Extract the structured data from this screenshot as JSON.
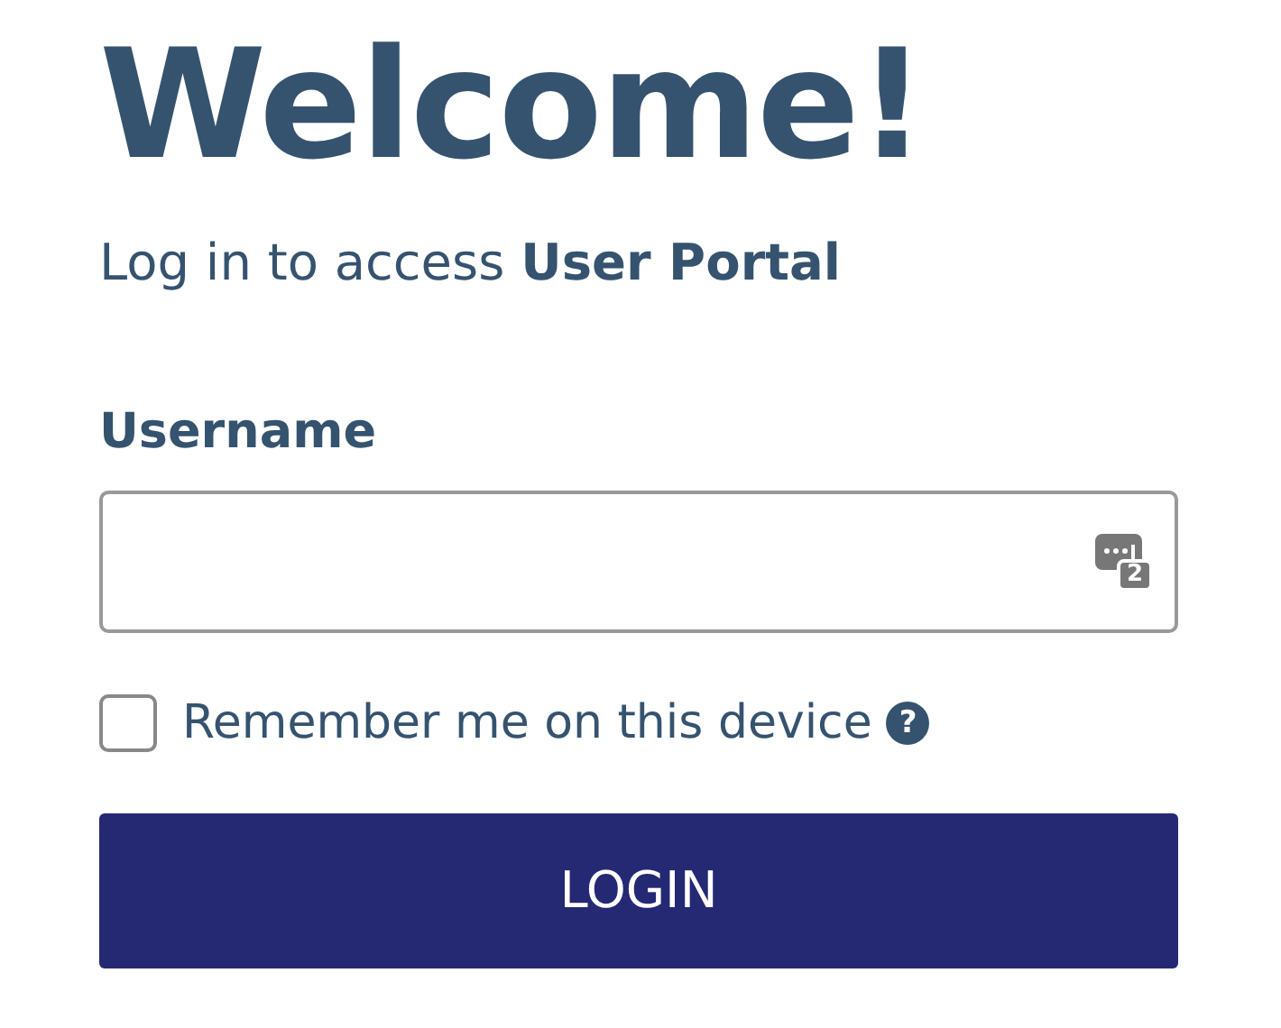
{
  "heading": "Welcome!",
  "subtitle": "Log in to access **User Portal**",
  "username": {
    "label": "Username",
    "badge": "2"
  },
  "remember": {
    "label": "Remember me on this device",
    "checked": false,
    "help": "?"
  },
  "login_button": "LOGIN"
}
